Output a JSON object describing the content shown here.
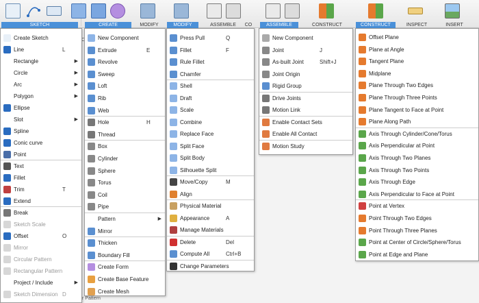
{
  "toolbar": {
    "tabs": [
      "SKETCH",
      "CREATE",
      "MODIFY",
      "MODIFY",
      "ASSEMBLE",
      "CO",
      "ASSEMBLE",
      "CONSTRUCT",
      "CONSTRUCT",
      "INSPECT",
      "INSERT"
    ]
  },
  "sketch_menu": {
    "items": [
      {
        "label": "Create Sketch"
      },
      {
        "label": "Line",
        "shortcut": "L"
      },
      {
        "label": "Rectangle"
      },
      {
        "label": "Circle"
      },
      {
        "label": "Arc"
      },
      {
        "label": "Polygon"
      },
      {
        "label": "Ellipse"
      },
      {
        "label": "Slot"
      },
      {
        "label": "Spline"
      },
      {
        "label": "Conic curve"
      },
      {
        "label": "Point"
      },
      {
        "label": "Text"
      },
      {
        "label": "Fillet"
      },
      {
        "label": "Trim",
        "shortcut": "T"
      },
      {
        "label": "Extend"
      },
      {
        "label": "Break"
      },
      {
        "label": "Sketch Scale"
      },
      {
        "label": "Offset",
        "shortcut": "O"
      },
      {
        "label": "Mirror"
      },
      {
        "label": "Circular Pattern"
      },
      {
        "label": "Rectangular Pattern"
      },
      {
        "label": "Project / Include"
      },
      {
        "label": "Sketch Dimension",
        "shortcut": "D"
      }
    ]
  },
  "create_menu": {
    "items": [
      {
        "label": "New Component"
      },
      {
        "label": "Extrude",
        "shortcut": "E"
      },
      {
        "label": "Revolve"
      },
      {
        "label": "Sweep"
      },
      {
        "label": "Loft"
      },
      {
        "label": "Rib"
      },
      {
        "label": "Web"
      },
      {
        "label": "Hole",
        "shortcut": "H"
      },
      {
        "label": "Thread"
      },
      {
        "label": "Box"
      },
      {
        "label": "Cylinder"
      },
      {
        "label": "Sphere"
      },
      {
        "label": "Torus"
      },
      {
        "label": "Coil"
      },
      {
        "label": "Pipe"
      },
      {
        "label": "Pattern"
      },
      {
        "label": "Mirror"
      },
      {
        "label": "Thicken"
      },
      {
        "label": "Boundary Fill"
      },
      {
        "label": "Create Form"
      },
      {
        "label": "Create Base Feature"
      },
      {
        "label": "Create Mesh"
      }
    ]
  },
  "modify_menu": {
    "items": [
      {
        "label": "Press Pull",
        "shortcut": "Q"
      },
      {
        "label": "Fillet",
        "shortcut": "F"
      },
      {
        "label": "Rule Fillet"
      },
      {
        "label": "Chamfer"
      },
      {
        "label": "Shell"
      },
      {
        "label": "Draft"
      },
      {
        "label": "Scale"
      },
      {
        "label": "Combine"
      },
      {
        "label": "Replace Face"
      },
      {
        "label": "Split Face"
      },
      {
        "label": "Split Body"
      },
      {
        "label": "Silhouette Split"
      },
      {
        "label": "Move/Copy",
        "shortcut": "M"
      },
      {
        "label": "Align"
      },
      {
        "label": "Physical Material"
      },
      {
        "label": "Appearance",
        "shortcut": "A"
      },
      {
        "label": "Manage Materials"
      },
      {
        "label": "Delete",
        "shortcut": "Del"
      },
      {
        "label": "Compute All",
        "shortcut": "Ctrl+B"
      },
      {
        "label": "Change Parameters"
      }
    ]
  },
  "assemble_menu": {
    "items": [
      {
        "label": "New Component"
      },
      {
        "label": "Joint",
        "shortcut": "J"
      },
      {
        "label": "As-built Joint",
        "shortcut": "Shift+J"
      },
      {
        "label": "Joint Origin"
      },
      {
        "label": "Rigid Group"
      },
      {
        "label": "Drive Joints"
      },
      {
        "label": "Motion Link"
      },
      {
        "label": "Enable Contact Sets"
      },
      {
        "label": "Enable All Contact"
      },
      {
        "label": "Motion Study"
      }
    ]
  },
  "construct_menu": {
    "items": [
      {
        "label": "Offset Plane"
      },
      {
        "label": "Plane at Angle"
      },
      {
        "label": "Tangent Plane"
      },
      {
        "label": "Midplane"
      },
      {
        "label": "Plane Through Two Edges"
      },
      {
        "label": "Plane Through Three Points"
      },
      {
        "label": "Plane Tangent to Face at Point"
      },
      {
        "label": "Plane Along Path"
      },
      {
        "label": "Axis Through Cylinder/Cone/Torus"
      },
      {
        "label": "Axis Perpendicular at Point"
      },
      {
        "label": "Axis Through Two Planes"
      },
      {
        "label": "Axis Through Two Points"
      },
      {
        "label": "Axis Through Edge"
      },
      {
        "label": "Axis Perpendicular to Face at Point"
      },
      {
        "label": "Point at Vertex"
      },
      {
        "label": "Point Through Two Edges"
      },
      {
        "label": "Point Through Three Planes"
      },
      {
        "label": "Point at Center of Circle/Sphere/Torus"
      },
      {
        "label": "Point at Edge and Plane"
      }
    ]
  },
  "behind_text": {
    "left_fragments": [
      "Cr",
      "Ex",
      "Re",
      "Sw",
      "Lo",
      "Rib",
      "We"
    ],
    "bottom_fragment": "r Pattern"
  },
  "colors": {
    "accent": "#4a90d9",
    "menu_border": "#9a9a9a",
    "disabled_text": "#9a9a9a"
  }
}
